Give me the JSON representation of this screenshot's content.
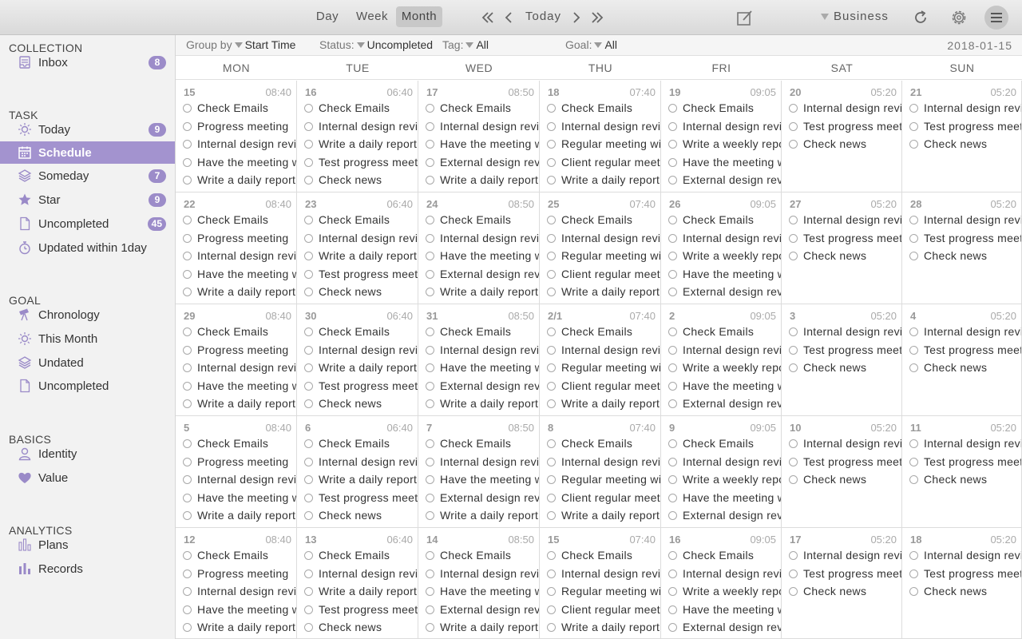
{
  "toolbar": {
    "view_tabs": [
      "Day",
      "Week",
      "Month"
    ],
    "active_view": "Month",
    "nav": {
      "first_icon": "double-chevron-left-icon",
      "prev_icon": "chevron-left-icon",
      "today": "Today",
      "next_icon": "chevron-right-icon",
      "last_icon": "double-chevron-right-icon"
    },
    "compose_icon": "compose-icon",
    "workspace": "Business",
    "refresh_icon": "refresh-icon",
    "settings_icon": "gear-icon",
    "menu_icon": "hamburger-menu-icon"
  },
  "sidebar": {
    "sections": [
      {
        "title": "COLLECTION",
        "items": [
          {
            "label": "Inbox",
            "badge": "8",
            "icon": "inbox-icon"
          }
        ]
      },
      {
        "title": "TASK",
        "items": [
          {
            "label": "Today",
            "badge": "9",
            "icon": "sun-icon"
          },
          {
            "label": "Schedule",
            "badge": "",
            "icon": "calendar-icon",
            "selected": true
          },
          {
            "label": "Someday",
            "badge": "7",
            "icon": "layers-icon"
          },
          {
            "label": "Star",
            "badge": "9",
            "icon": "star-icon"
          },
          {
            "label": "Uncompleted",
            "badge": "45",
            "icon": "document-icon"
          },
          {
            "label": "Updated within 1day",
            "badge": "",
            "icon": "stopwatch-icon"
          }
        ]
      },
      {
        "title": "GOAL",
        "items": [
          {
            "label": "Chronology",
            "badge": "",
            "icon": "telescope-icon"
          },
          {
            "label": "This Month",
            "badge": "",
            "icon": "sun-icon"
          },
          {
            "label": "Undated",
            "badge": "",
            "icon": "layers-icon"
          },
          {
            "label": "Uncompleted",
            "badge": "",
            "icon": "document-icon"
          }
        ]
      },
      {
        "title": "BASICS",
        "items": [
          {
            "label": "Identity",
            "badge": "",
            "icon": "person-icon"
          },
          {
            "label": "Value",
            "badge": "",
            "icon": "heart-icon"
          }
        ]
      },
      {
        "title": "ANALYTICS",
        "items": [
          {
            "label": "Plans",
            "badge": "",
            "icon": "bar-chart-outline-icon"
          },
          {
            "label": "Records",
            "badge": "",
            "icon": "bar-chart-icon"
          }
        ]
      }
    ]
  },
  "filters": {
    "group_by_label": "Group by",
    "group_by_value": "Start Time",
    "status_label": "Status:",
    "status_value": "Uncompleted",
    "tag_label": "Tag:",
    "tag_value": "All",
    "goal_label": "Goal:",
    "goal_value": "All",
    "date": "2018-01-15"
  },
  "calendar": {
    "weekdays": [
      "MON",
      "TUE",
      "WED",
      "THU",
      "FRI",
      "SAT",
      "SUN"
    ],
    "day_times": [
      "08:40",
      "06:40",
      "08:50",
      "07:40",
      "09:05",
      "05:20",
      "05:20"
    ],
    "day_tasks": [
      [
        "Check Emails",
        "Progress meeting",
        "Internal design review",
        "Have the meeting with",
        "Write a daily report"
      ],
      [
        "Check Emails",
        "Internal design review",
        "Write a daily report",
        "Test progress meeting",
        "Check news"
      ],
      [
        "Check Emails",
        "Internal design review",
        "Have the meeting with",
        "External design review",
        "Write a daily report"
      ],
      [
        "Check Emails",
        "Internal design review",
        "Regular meeting with",
        "Client regular meeting",
        "Write a daily report"
      ],
      [
        "Check Emails",
        "Internal design review",
        "Write a weekly report",
        "Have the meeting with",
        "External design review"
      ],
      [
        "Internal design review",
        "Test progress meeting",
        "Check news"
      ],
      [
        "Internal design review",
        "Test progress meeting",
        "Check news"
      ]
    ],
    "weeks": [
      [
        "15",
        "16",
        "17",
        "18",
        "19",
        "20",
        "21"
      ],
      [
        "22",
        "23",
        "24",
        "25",
        "26",
        "27",
        "28"
      ],
      [
        "29",
        "30",
        "31",
        "2/1",
        "2",
        "3",
        "4"
      ],
      [
        "5",
        "6",
        "7",
        "8",
        "9",
        "10",
        "11"
      ],
      [
        "12",
        "13",
        "14",
        "15",
        "16",
        "17",
        "18"
      ]
    ]
  }
}
